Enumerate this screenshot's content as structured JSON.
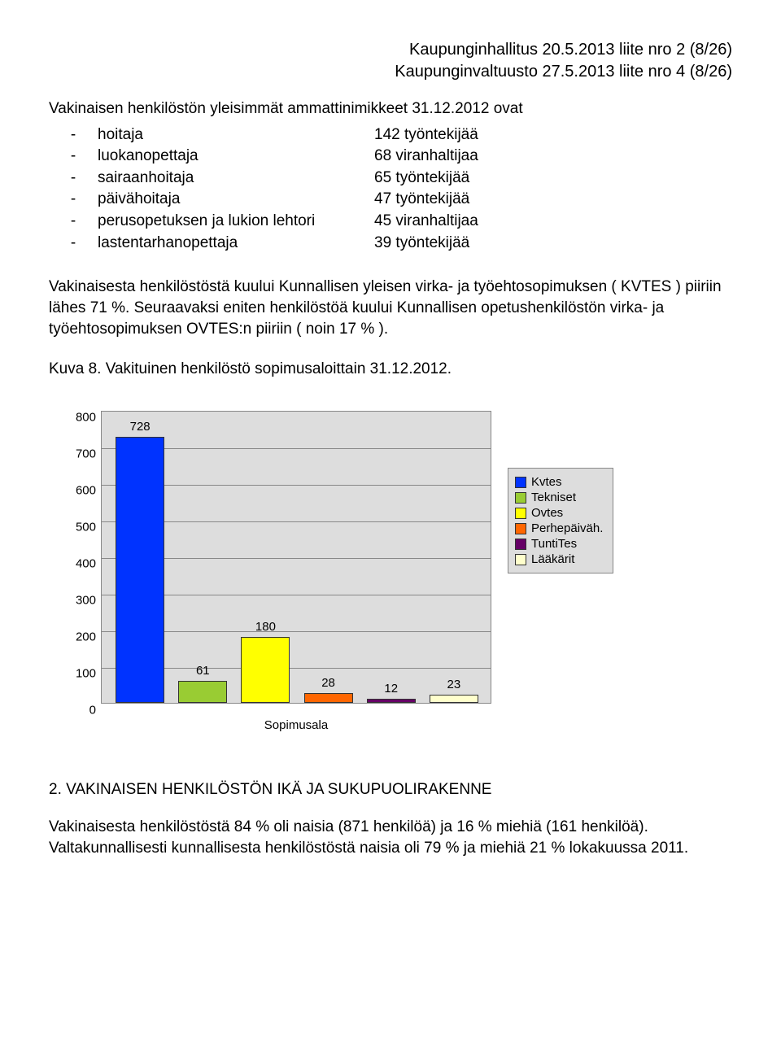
{
  "header": {
    "line1": "Kaupunginhallitus 20.5.2013 liite nro 2 (8/26)",
    "line2": "Kaupunginvaltuusto 27.5.2013 liite nro 4 (8/26)"
  },
  "intro": "Vakinaisen henkilöstön yleisimmät ammattinimikkeet 31.12.2012 ovat",
  "jobs": [
    {
      "title": "hoitaja",
      "count": "142 työntekijää"
    },
    {
      "title": "luokanopettaja",
      "count": "68 viranhaltijaa"
    },
    {
      "title": "sairaanhoitaja",
      "count": "65 työntekijää"
    },
    {
      "title": "päivähoitaja",
      "count": "47 työntekijää"
    },
    {
      "title": "perusopetuksen ja lukion lehtori",
      "count": "45 viranhaltijaa"
    },
    {
      "title": "lastentarhanopettaja",
      "count": "39 työntekijää"
    }
  ],
  "body_para": "Vakinaisesta henkilöstöstä kuului Kunnallisen yleisen virka- ja työehtosopimuksen ( KVTES ) piiriin lähes 71 %. Seuraavaksi eniten henkilöstöä kuului Kunnallisen opetushenkilöstön virka- ja työehtosopimuksen OVTES:n piiriin  ( noin 17 % ).",
  "caption": "Kuva 8. Vakituinen henkilöstö sopimusaloittain 31.12.2012.",
  "chart_data": {
    "type": "bar",
    "categories": [
      "Kvtes",
      "Tekniset",
      "Ovtes",
      "Perhepäiväh.",
      "TuntiTes",
      "Lääkärit"
    ],
    "values": [
      728,
      61,
      180,
      28,
      12,
      23
    ],
    "colors": [
      "#0033ff",
      "#99cc33",
      "#ffff00",
      "#ff6600",
      "#660066",
      "#ffffcc"
    ],
    "xlabel": "Sopimusala",
    "ylabel": "",
    "ylim": [
      0,
      800
    ],
    "y_ticks": [
      0,
      100,
      200,
      300,
      400,
      500,
      600,
      700,
      800
    ]
  },
  "section_heading": "2. VAKINAISEN HENKILÖSTÖN IKÄ JA SUKUPUOLIRAKENNE",
  "footer_para": "Vakinaisesta henkilöstöstä 84 % oli naisia (871 henkilöä) ja 16 % miehiä (161 henkilöä). Valtakunnallisesti kunnallisesta henkilöstöstä naisia oli 79 % ja miehiä 21 % lokakuussa 2011."
}
